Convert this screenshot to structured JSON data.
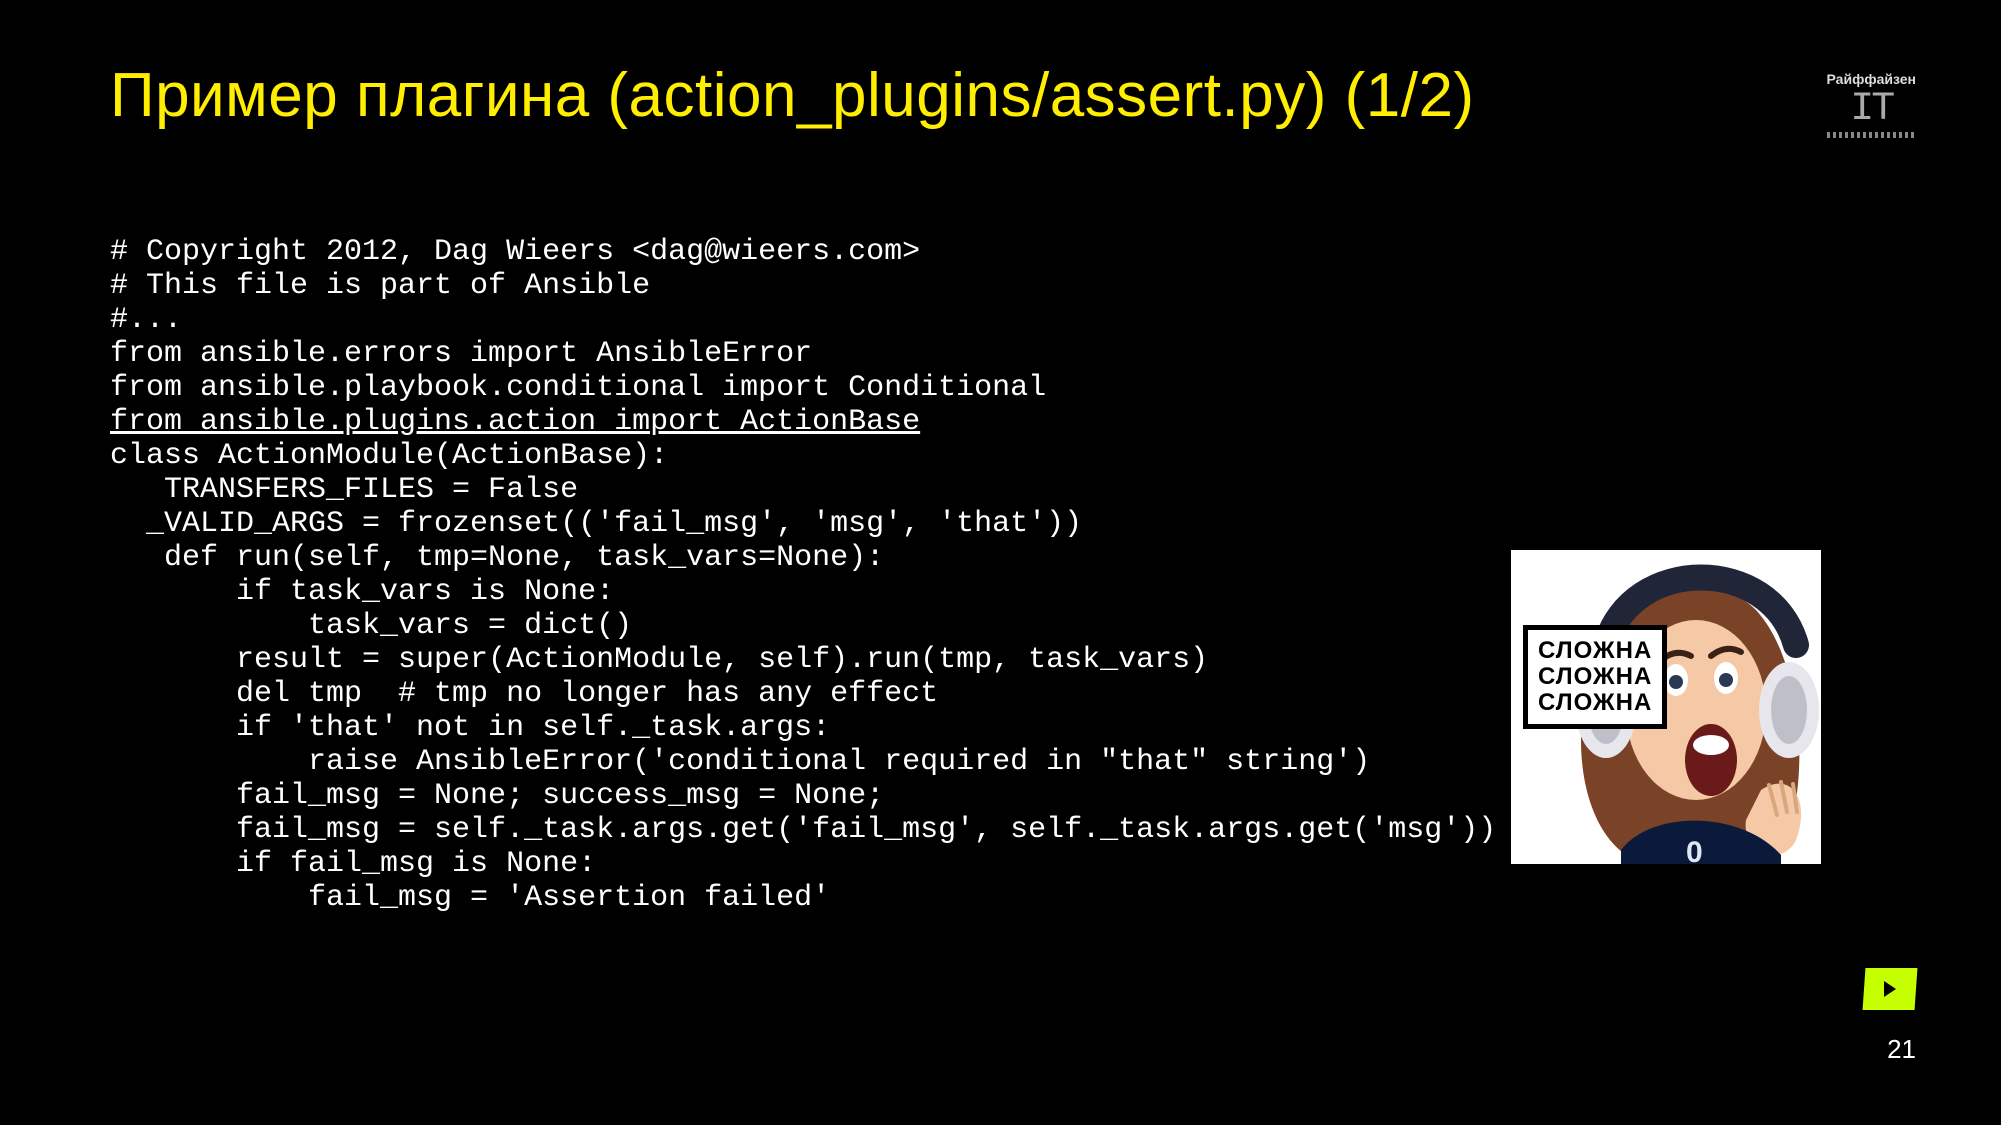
{
  "title": "Пример плагина (action_plugins/assert.py) (1/2)",
  "brand": {
    "name": "Райффайзен",
    "it": "IT"
  },
  "meme": {
    "line1": "СЛОЖНА",
    "line2": "СЛОЖНА",
    "line3": "СЛОЖНА"
  },
  "page_number": "21",
  "code": {
    "l01": "# Copyright 2012, Dag Wieers <dag@wieers.com>",
    "l02": "# This file is part of Ansible",
    "l03": "#...",
    "l04": "from ansible.errors import AnsibleError",
    "l05": "from ansible.playbook.conditional import Conditional",
    "l06": "from ansible.plugins.action import ActionBase",
    "l07": "class ActionModule(ActionBase):",
    "l08": "   TRANSFERS_FILES = False",
    "l09": "  _VALID_ARGS = frozenset(('fail_msg', 'msg', 'that'))",
    "l10": "   def run(self, tmp=None, task_vars=None):",
    "l11": "       if task_vars is None:",
    "l12": "           task_vars = dict()",
    "l13": "       result = super(ActionModule, self).run(tmp, task_vars)",
    "l14": "       del tmp  # tmp no longer has any effect",
    "l15": "       if 'that' not in self._task.args:",
    "l16": "           raise AnsibleError('conditional required in \"that\" string')",
    "l17": "       fail_msg = None; success_msg = None;",
    "l18": "       fail_msg = self._task.args.get('fail_msg', self._task.args.get('msg'))",
    "l19": "       if fail_msg is None:",
    "l20": "           fail_msg = 'Assertion failed'"
  }
}
